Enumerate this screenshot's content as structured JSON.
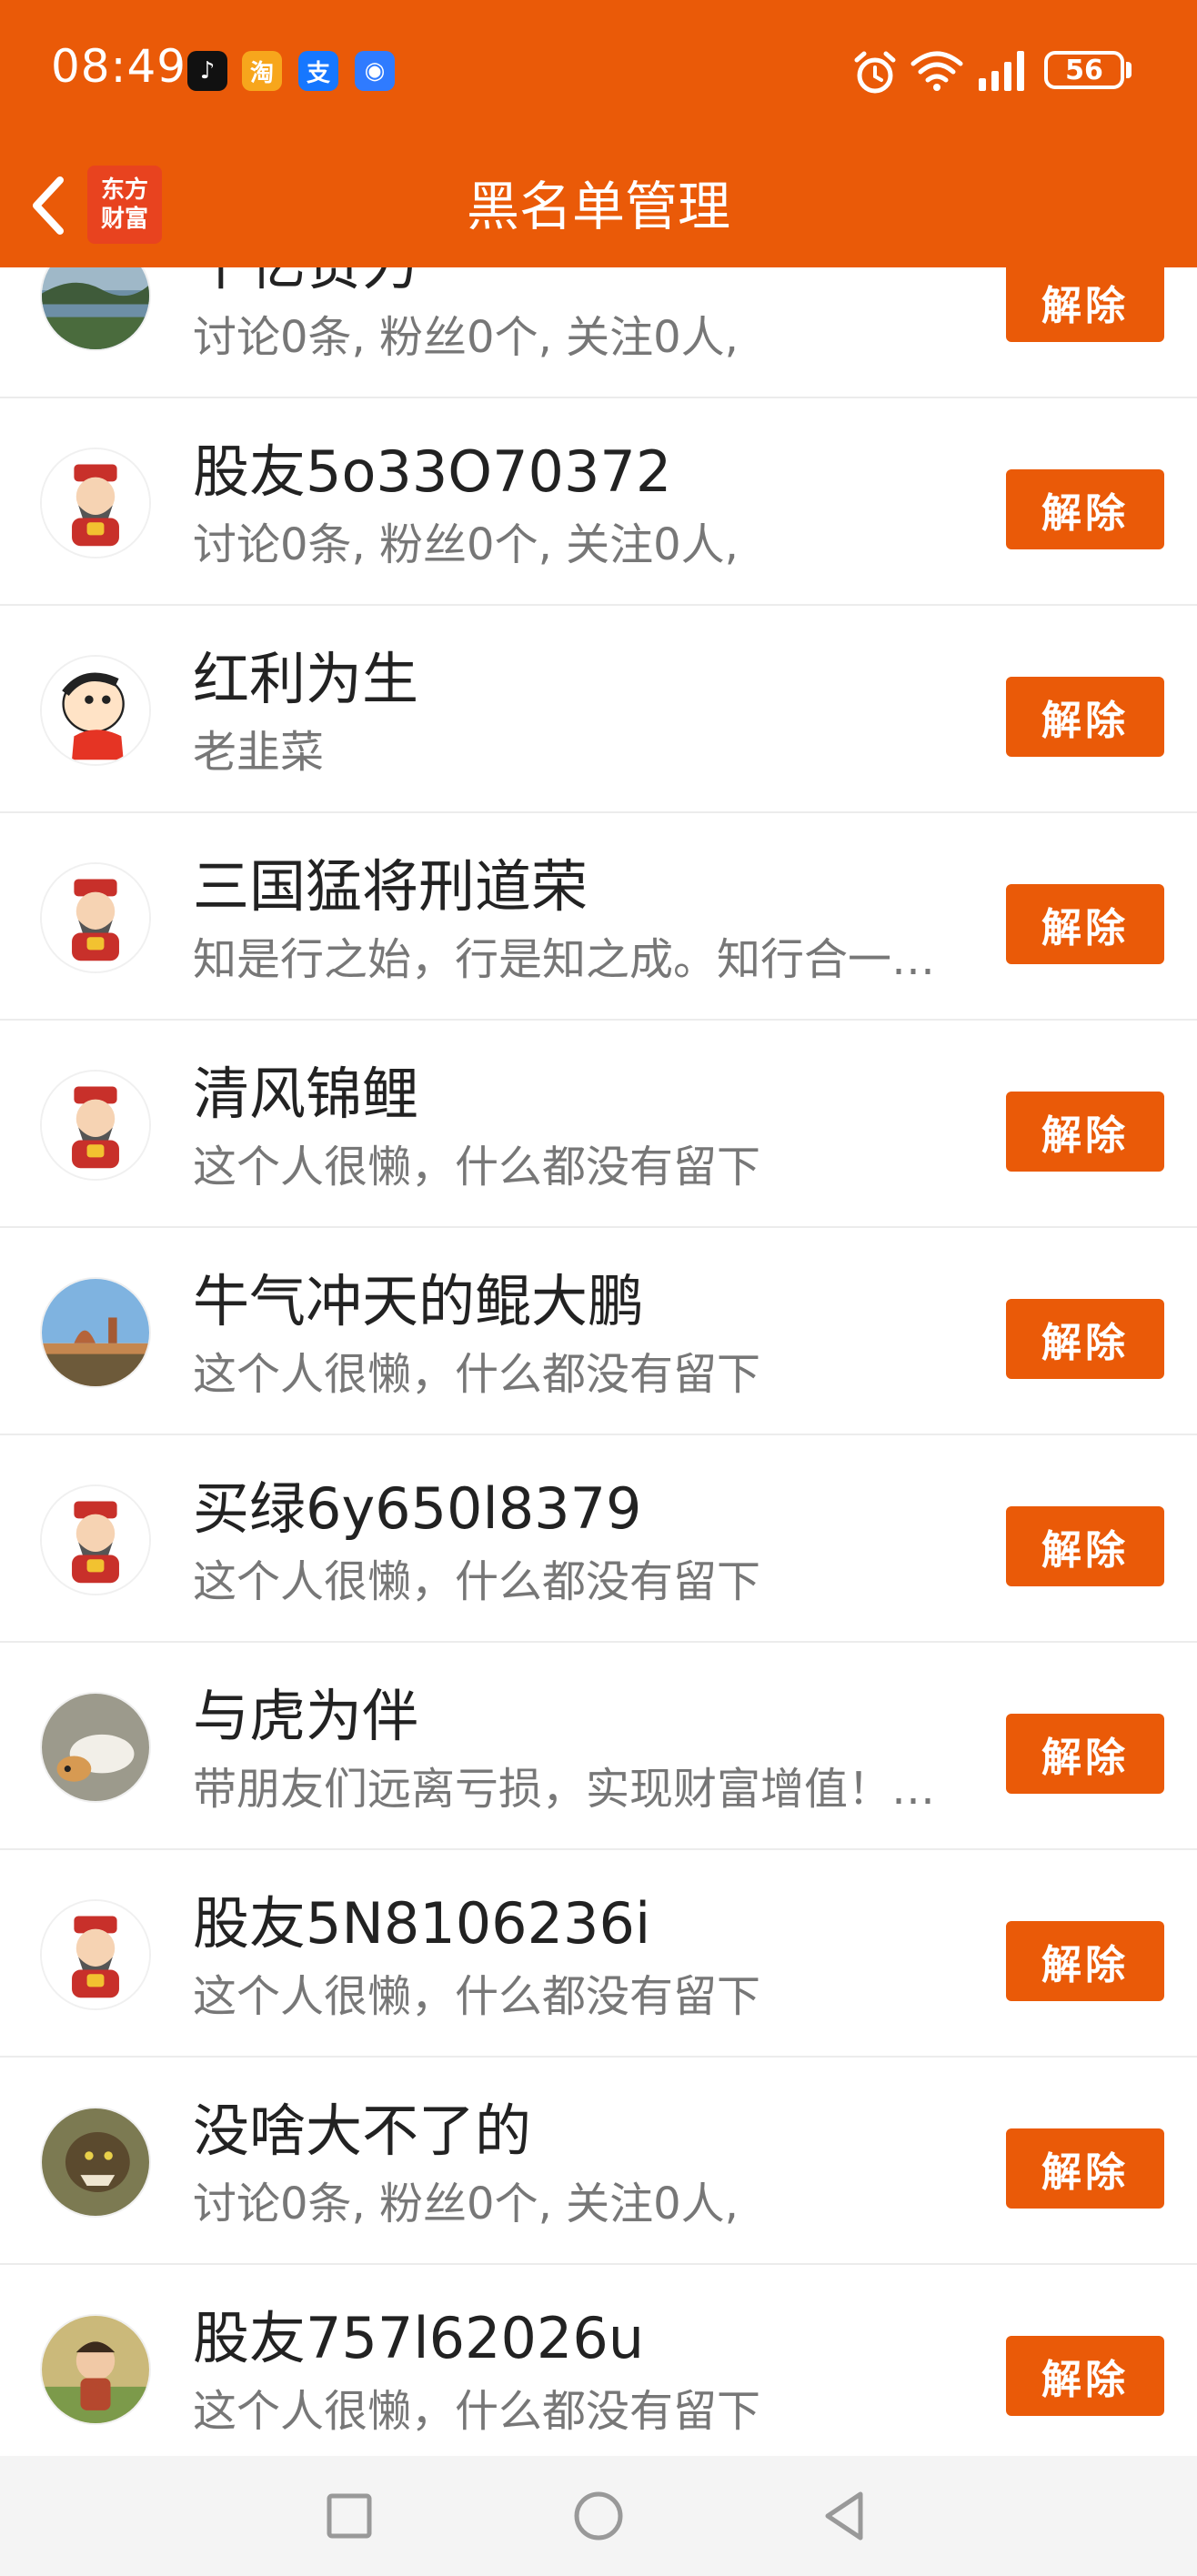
{
  "status_bar": {
    "time": "08:49",
    "battery": "56",
    "apps": [
      {
        "icon": "tiktok-icon",
        "glyph": "♪"
      },
      {
        "icon": "taobao-icon",
        "glyph": "淘"
      },
      {
        "icon": "alipay-icon",
        "glyph": "支"
      },
      {
        "icon": "assistant-icon",
        "glyph": "◉"
      }
    ]
  },
  "header": {
    "title": "黑名单管理",
    "logo_line1": "东方",
    "logo_line2": "财富",
    "accent_color": "#ea5a08"
  },
  "remove_label": "解除",
  "items": [
    {
      "name": "千亿赞力",
      "desc": "讨论0条, 粉丝0个, 关注0人,",
      "avatar": "lake"
    },
    {
      "name": "股友5o33O70372",
      "desc": "讨论0条, 粉丝0个, 关注0人,",
      "avatar": "god"
    },
    {
      "name": "红利为生",
      "desc": "老韭菜",
      "avatar": "cartoon"
    },
    {
      "name": "三国猛将刑道荣",
      "desc": "知是行之始，行是知之成。知行合一…",
      "avatar": "god"
    },
    {
      "name": "清风锦鲤",
      "desc": "这个人很懒，什么都没有留下",
      "avatar": "god"
    },
    {
      "name": "牛气冲天的鲲大鹏",
      "desc": "这个人很懒，什么都没有留下",
      "avatar": "city"
    },
    {
      "name": "买绿6y650l8379",
      "desc": "这个人很懒，什么都没有留下",
      "avatar": "god"
    },
    {
      "name": "与虎为伴",
      "desc": "带朋友们远离亏损，实现财富增值！…",
      "avatar": "dog"
    },
    {
      "name": "股友5N8106236i",
      "desc": "这个人很懒，什么都没有留下",
      "avatar": "god"
    },
    {
      "name": "没啥大不了的",
      "desc": "讨论0条, 粉丝0个, 关注0人,",
      "avatar": "beast"
    },
    {
      "name": "股友757l62026u",
      "desc": "这个人很懒，什么都没有留下",
      "avatar": "child"
    }
  ]
}
